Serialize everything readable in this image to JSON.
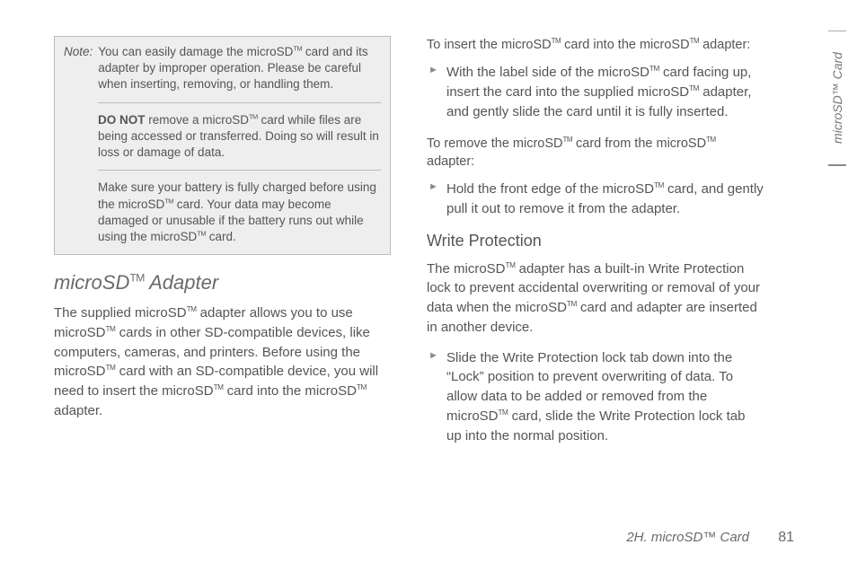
{
  "sideTab": "microSD™ Card",
  "note": {
    "label": "Note:",
    "p1_a": "You can easily damage the microSD",
    "p1_b": " card and its adapter  by improper operation. Please be careful when inserting, removing, or handling them.",
    "p2_bold": "DO NOT",
    "p2_a": " remove a microSD",
    "p2_b": " card while files are being accessed or transferred. Doing so will result in loss or damage of data.",
    "p3_a": "Make sure your battery is fully charged before using the microSD",
    "p3_b": " card. Your data may become damaged or unusable if the battery runs out while using the microSD",
    "p3_c": " card."
  },
  "left": {
    "h2_a": "microSD",
    "h2_b": " Adapter",
    "p1_a": "The supplied microSD",
    "p1_b": " adapter allows you to use microSD",
    "p1_c": " cards in other SD-compatible devices, like computers, cameras, and printers. Before using the microSD",
    "p1_d": " card with an SD-compatible device, you will need to insert the microSD",
    "p1_e": " card into the microSD",
    "p1_f": " adapter."
  },
  "right": {
    "lead1_a": "To insert the microSD",
    "lead1_b": " card into the microSD",
    "lead1_c": " adapter:",
    "b1_a": "With the label side of the microSD",
    "b1_b": " card facing up, insert the card into the supplied microSD",
    "b1_c": " adapter, and gently slide the card until it is fully inserted.",
    "lead2_a": "To remove the microSD",
    "lead2_b": " card from the microSD",
    "lead2_c": " adapter:",
    "b2_a": "Hold the front edge of the microSD",
    "b2_b": " card, and gently pull it out to remove it from the adapter.",
    "h3": "Write Protection",
    "wp_p_a": "The microSD",
    "wp_p_b": " adapter has a built-in Write Protection lock to prevent accidental overwriting or removal of your data when the microSD",
    "wp_p_c": " card and adapter are inserted in another device.",
    "b3_a": "Slide the Write Protection lock tab down into the “Lock” position to prevent overwriting of data. To allow data to be added or removed from the microSD",
    "b3_b": " card, slide the Write Protection lock tab up into the normal position."
  },
  "footer": {
    "section": "2H. microSD™ Card",
    "page": "81"
  },
  "tm": "TM"
}
